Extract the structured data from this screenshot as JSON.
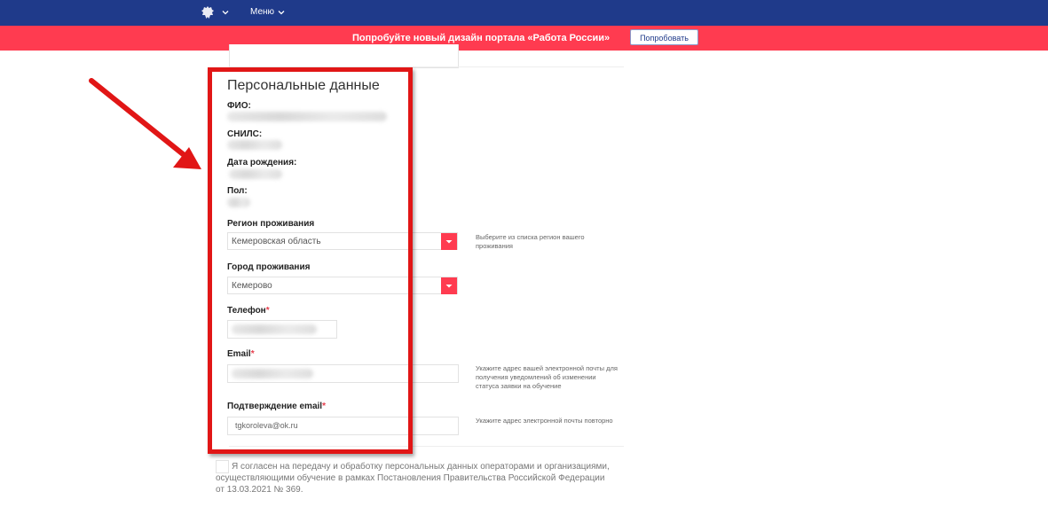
{
  "header": {
    "menu_label": "Меню",
    "emblem_icon": "double-headed-eagle-icon",
    "bg_color": "#1f3a8a"
  },
  "banner": {
    "text": "Попробуйте новый дизайн портала «Работа России»",
    "button_label": "Попробовать",
    "bg_color": "#ff3b50"
  },
  "form": {
    "section_title": "Персональные данные",
    "fio_label": "ФИО:",
    "snils_label": "СНИЛС:",
    "birth_label": "Дата рождения:",
    "gender_label": "Пол:",
    "region_label": "Регион проживания",
    "region_value": "Кемеровская область",
    "region_hint": "Выберите из списка регион вашего проживания",
    "city_label": "Город проживания",
    "city_value": "Кемерово",
    "phone_label": "Телефон",
    "email_label": "Email",
    "email_hint": "Укажите адрес вашей электронной почты для получения уведомлений об изменении статуса заявки на обучение",
    "email_confirm_label": "Подтверждение email",
    "email_confirm_value": "tgkoroleva@ok.ru",
    "email_confirm_hint": "Укажите адрес электронной почты повторно",
    "required_mark": "*",
    "consent_text": "Я согласен на передачу и обработку персональных данных операторами и организациями, осуществляющими обучение в рамках Постановления Правительства Российской Федерации от 13.03.2021 № 369."
  },
  "annotation": {
    "color": "#e11616"
  }
}
